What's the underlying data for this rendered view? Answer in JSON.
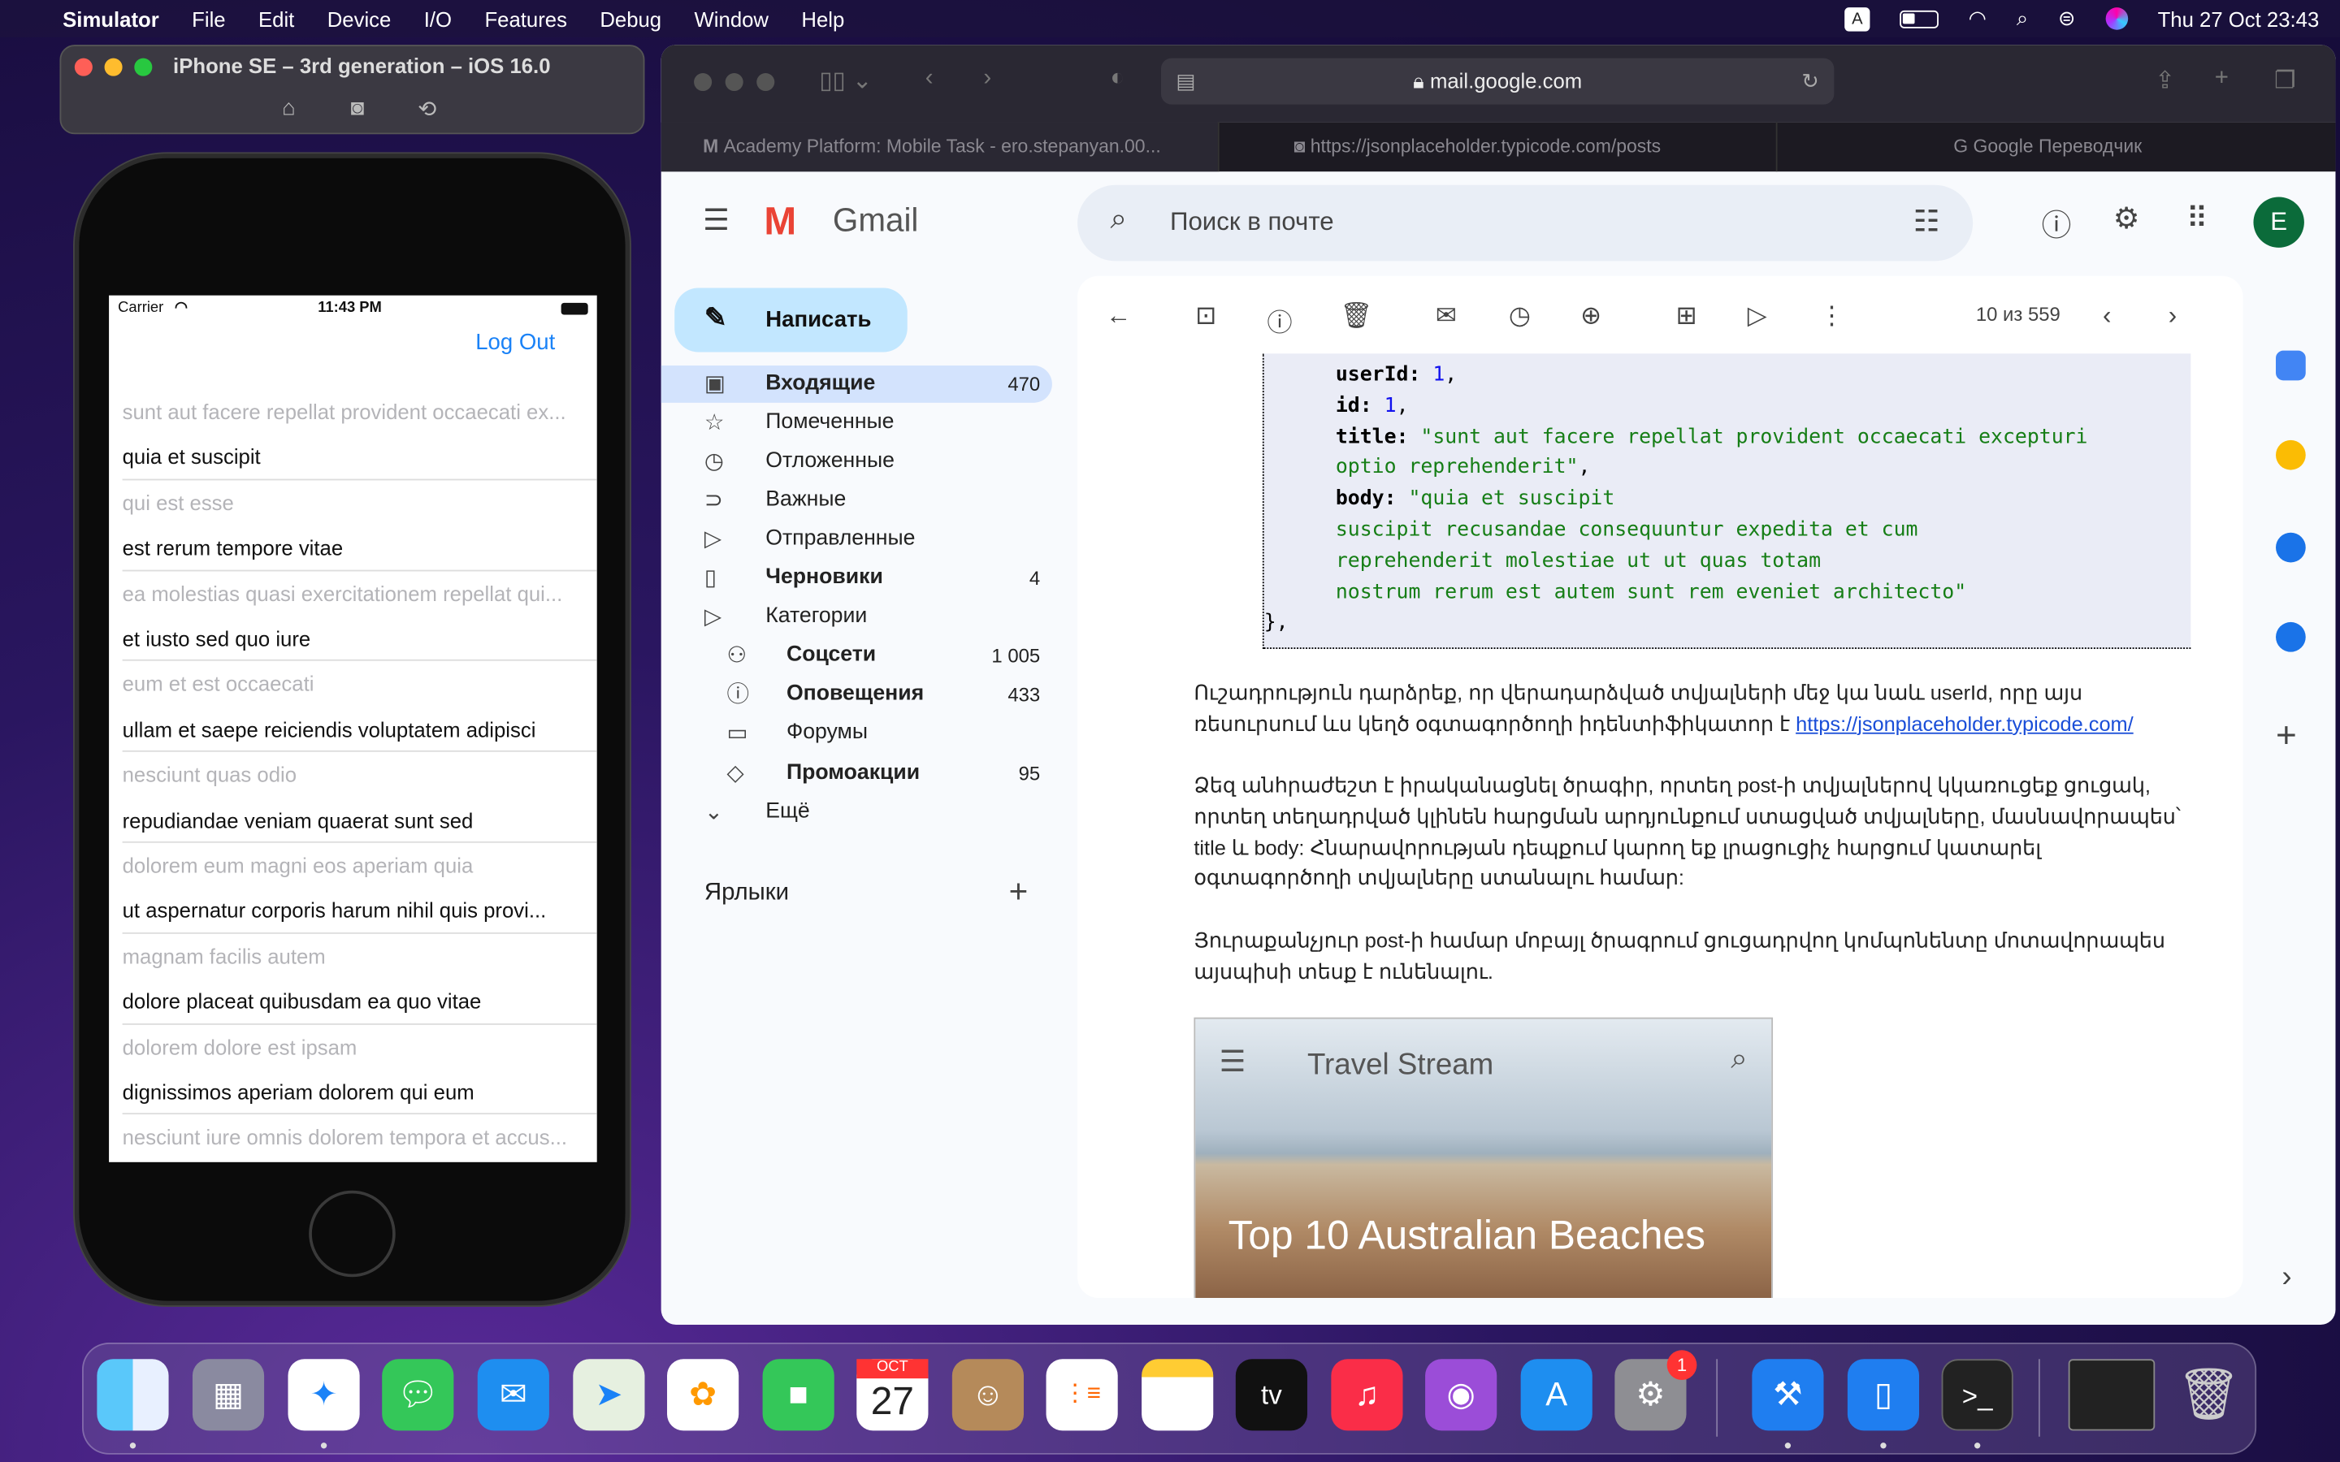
{
  "menubar": {
    "app": "Simulator",
    "items": [
      "File",
      "Edit",
      "Device",
      "I/O",
      "Features",
      "Debug",
      "Window",
      "Help"
    ],
    "input_source": "A",
    "datetime": "Thu 27 Oct  23:43"
  },
  "simulator": {
    "title": "iPhone SE – 3rd generation – iOS 16.0"
  },
  "phone": {
    "carrier": "Carrier",
    "time": "11:43 PM",
    "logout": "Log Out",
    "rows": [
      {
        "text": "sunt aut facere repellat provident occaecati ex...",
        "style": "title"
      },
      {
        "text": "quia et suscipit",
        "style": "body"
      },
      {
        "text": "qui est esse",
        "style": "title"
      },
      {
        "text": "est rerum tempore vitae",
        "style": "body"
      },
      {
        "text": "ea molestias quasi exercitationem repellat qui...",
        "style": "title"
      },
      {
        "text": "et iusto sed quo iure",
        "style": "body"
      },
      {
        "text": "eum et est occaecati",
        "style": "title"
      },
      {
        "text": "ullam et saepe reiciendis voluptatem adipisci",
        "style": "body"
      },
      {
        "text": "nesciunt quas odio",
        "style": "title"
      },
      {
        "text": "repudiandae veniam quaerat sunt sed",
        "style": "body"
      },
      {
        "text": "dolorem eum magni eos aperiam quia",
        "style": "title"
      },
      {
        "text": "ut aspernatur corporis harum nihil quis provi...",
        "style": "body"
      },
      {
        "text": "magnam facilis autem",
        "style": "title"
      },
      {
        "text": "dolore placeat quibusdam ea quo vitae",
        "style": "body"
      },
      {
        "text": "dolorem dolore est ipsam",
        "style": "title"
      },
      {
        "text": "dignissimos aperiam dolorem qui eum",
        "style": "body"
      },
      {
        "text": "nesciunt iure omnis dolorem tempora et accus...",
        "style": "title"
      }
    ]
  },
  "safari": {
    "url": "mail.google.com",
    "tabs": [
      "Academy Platform: Mobile Task - ero.stepanyan.00...",
      "https://jsonplaceholder.typicode.com/posts",
      "Google Переводчик"
    ]
  },
  "gmail": {
    "logo": "Gmail",
    "search_placeholder": "Поиск в почте",
    "avatar": "E",
    "compose": "Написать",
    "nav": [
      {
        "label": "Входящие",
        "count": "470",
        "icon": "inbox-icon",
        "glyph": "▣"
      },
      {
        "label": "Помеченные",
        "count": "",
        "icon": "star-icon",
        "glyph": "☆"
      },
      {
        "label": "Отложенные",
        "count": "",
        "icon": "clock-icon",
        "glyph": "◷"
      },
      {
        "label": "Важные",
        "count": "",
        "icon": "important-icon",
        "glyph": "⊃"
      },
      {
        "label": "Отправленные",
        "count": "",
        "icon": "send-icon",
        "glyph": "▷"
      },
      {
        "label": "Черновики",
        "count": "4",
        "icon": "draft-icon",
        "glyph": "▯"
      },
      {
        "label": "Категории",
        "count": "",
        "icon": "label-icon",
        "glyph": "▷"
      },
      {
        "label": "Соцсети",
        "count": "1 005",
        "icon": "people-icon",
        "glyph": "⚇"
      },
      {
        "label": "Оповещения",
        "count": "433",
        "icon": "info-icon",
        "glyph": "ⓘ"
      },
      {
        "label": "Форумы",
        "count": "",
        "icon": "forum-icon",
        "glyph": "▭"
      },
      {
        "label": "Промоакции",
        "count": "95",
        "icon": "tag-icon",
        "glyph": "◇"
      },
      {
        "label": "Ещё",
        "count": "",
        "icon": "chevron-down-icon",
        "glyph": "⌄"
      }
    ],
    "labels_heading": "Ярлыки",
    "pagination": "10 из 559",
    "code": {
      "userId_key": "userId:",
      "userId": "1",
      "id_key": "id:",
      "id": "1",
      "title_key": "title:",
      "title_l1": "\"sunt aut facere repellat provident occaecati excepturi",
      "title_l2": "optio reprehenderit\"",
      "body_key": "body:",
      "body_l1": "\"quia et suscipit",
      "body_l2": "suscipit recusandae consequuntur expedita et cum",
      "body_l3": "reprehenderit molestiae ut ut quas totam",
      "body_l4": "nostrum rerum est autem sunt rem eveniet architecto\"",
      "close": "},"
    },
    "para1": "Ուշադրություն դարձրեք, որ վերադարձված տվյալների մեջ կա նաև userId, որը այս ռեսուրսում ևս կեղծ օգտագործողի իդենտիֆիկատոր է ",
    "para1_link": "https://jsonplaceholder.typicode.com/",
    "para2": "Ձեզ անհրաժեշտ է իրականացնել ծրագիր, որտեղ post-ի տվյալներով կկառուցեք ցուցակ, որտեղ տեղադրված կլինեն հարցման արդյունքում ստացված տվյալները, մասնավորապես՝ title և body: Հնարավորության դեպքում կարող եք լրացուցիչ հարցում կատարել օգտագործողի տվյալները ստանալու համար:",
    "para3": "Յուրաքանչյուր post-ի համար մոբայլ ծրագրում ցուցադրվող կոմպոնենտը մոտավորապես այսպիսի տեսք է ունենալու.",
    "image": {
      "app_title": "Travel Stream",
      "headline": "Top 10 Australian Beaches"
    }
  },
  "dock": {
    "calendar_month": "OCT",
    "calendar_day": "27",
    "settings_badge": "1",
    "tv_label": "tv"
  }
}
